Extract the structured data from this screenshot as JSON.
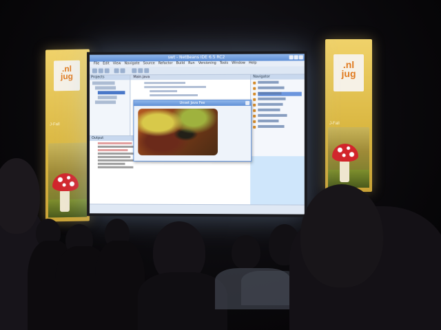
{
  "left_banner": {
    "logo": ".nl\njug",
    "tagline": "J-Fall"
  },
  "right_banner": {
    "logo": ".nl\njug",
    "tagline": "J-Fall"
  },
  "screen": {
    "window_title": "swt - NetBeans IDE 6.5 RC2",
    "menu_items": [
      "File",
      "Edit",
      "View",
      "Navigate",
      "Source",
      "Refactor",
      "Build",
      "Run",
      "Versioning",
      "Tools",
      "Window",
      "Help"
    ],
    "projects_header": "Projects",
    "editor_tab": "Main.java",
    "navigator_header": "Navigator",
    "output_header": "Output",
    "dialog_title": "Unset Java Fee"
  },
  "colors": {
    "banner_yellow": "#d9b640",
    "logo_orange": "#e07a1f",
    "mushroom_red": "#d2252b",
    "ide_blue": "#5f8fd6",
    "screen_glow": "#cfe6fb"
  }
}
